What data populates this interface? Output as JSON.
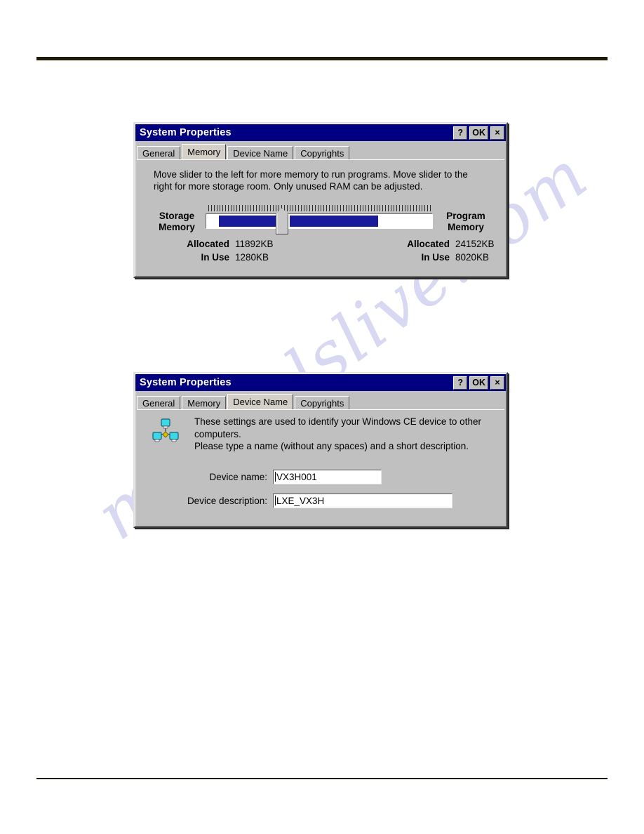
{
  "page": {
    "background": "#ffffff",
    "rule_color": "#1c1c08",
    "watermark_text": "manualslive.com",
    "watermark_color": "#b9b9e8"
  },
  "dialogs": [
    {
      "id": "memory",
      "title": "System Properties",
      "titlebar_color": "#000080",
      "buttons": [
        {
          "name": "help-button",
          "label": "?"
        },
        {
          "name": "ok-button",
          "label": "OK"
        },
        {
          "name": "close-button",
          "label": "×"
        }
      ],
      "tabs": [
        {
          "label": "General",
          "active": false
        },
        {
          "label": "Memory",
          "active": true
        },
        {
          "label": "Device Name",
          "active": false
        },
        {
          "label": "Copyrights",
          "active": false
        }
      ],
      "description": "Move slider to the left for more memory to run programs. Move slider to the right for more storage room. Only unused RAM can be adjusted.",
      "slider": {
        "left_label_line1": "Storage",
        "left_label_line2": "Memory",
        "right_label_line1": "Program",
        "right_label_line2": "Memory",
        "fill_color": "#1a1a9c",
        "thumb_position_percent": 31
      },
      "stats": {
        "storage": [
          {
            "key": "Allocated",
            "value": "11892KB"
          },
          {
            "key": "In Use",
            "value": "1280KB"
          }
        ],
        "program": [
          {
            "key": "Allocated",
            "value": "24152KB"
          },
          {
            "key": "In Use",
            "value": "8020KB"
          }
        ]
      }
    },
    {
      "id": "device-name",
      "title": "System Properties",
      "titlebar_color": "#000080",
      "buttons": [
        {
          "name": "help-button",
          "label": "?"
        },
        {
          "name": "ok-button",
          "label": "OK"
        },
        {
          "name": "close-button",
          "label": "×"
        }
      ],
      "tabs": [
        {
          "label": "General",
          "active": false
        },
        {
          "label": "Memory",
          "active": false
        },
        {
          "label": "Device Name",
          "active": true
        },
        {
          "label": "Copyrights",
          "active": false
        }
      ],
      "description_line1": "These settings are used to identify your Windows CE device to other computers.",
      "description_line2": "Please type a name (without any spaces) and a short description.",
      "icon": "network-computers-icon",
      "fields": [
        {
          "label": "Device name:",
          "value": "VX3H001"
        },
        {
          "label": "Device description:",
          "value": "LXE_VX3H"
        }
      ]
    }
  ]
}
